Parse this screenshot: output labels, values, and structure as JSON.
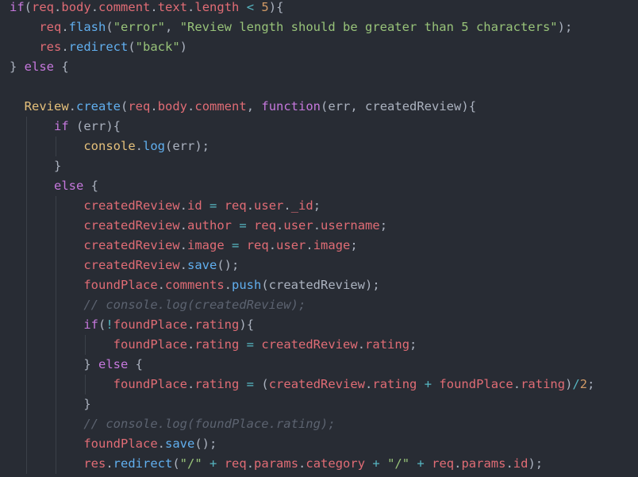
{
  "editor": {
    "colors": {
      "background": "#282c34",
      "keyword": "#c678dd",
      "variable": "#e06c75",
      "function": "#61afef",
      "string": "#98c379",
      "number": "#d19a66",
      "object": "#e5c07b",
      "operator": "#56b6c2",
      "punctuation": "#abb2bf",
      "comment": "#5c6370"
    },
    "lines": [
      {
        "indent": 0,
        "tokens": [
          {
            "t": "kw",
            "v": "if"
          },
          {
            "t": "punc",
            "v": "("
          },
          {
            "t": "var",
            "v": "req"
          },
          {
            "t": "punc",
            "v": "."
          },
          {
            "t": "var",
            "v": "body"
          },
          {
            "t": "punc",
            "v": "."
          },
          {
            "t": "var",
            "v": "comment"
          },
          {
            "t": "punc",
            "v": "."
          },
          {
            "t": "var",
            "v": "text"
          },
          {
            "t": "punc",
            "v": "."
          },
          {
            "t": "var",
            "v": "length"
          },
          {
            "t": "plain",
            "v": " "
          },
          {
            "t": "op",
            "v": "<"
          },
          {
            "t": "plain",
            "v": " "
          },
          {
            "t": "num",
            "v": "5"
          },
          {
            "t": "punc",
            "v": "){"
          }
        ]
      },
      {
        "indent": 4,
        "tokens": [
          {
            "t": "var",
            "v": "req"
          },
          {
            "t": "punc",
            "v": "."
          },
          {
            "t": "fn",
            "v": "flash"
          },
          {
            "t": "punc",
            "v": "("
          },
          {
            "t": "str",
            "v": "\"error\""
          },
          {
            "t": "punc",
            "v": ", "
          },
          {
            "t": "str",
            "v": "\"Review length should be greater than 5 characters\""
          },
          {
            "t": "punc",
            "v": ");"
          }
        ]
      },
      {
        "indent": 4,
        "tokens": [
          {
            "t": "var",
            "v": "res"
          },
          {
            "t": "punc",
            "v": "."
          },
          {
            "t": "fn",
            "v": "redirect"
          },
          {
            "t": "punc",
            "v": "("
          },
          {
            "t": "str",
            "v": "\"back\""
          },
          {
            "t": "punc",
            "v": ")"
          }
        ]
      },
      {
        "indent": 0,
        "tokens": [
          {
            "t": "punc",
            "v": "} "
          },
          {
            "t": "kw",
            "v": "else"
          },
          {
            "t": "punc",
            "v": " {"
          }
        ]
      },
      {
        "indent": 0,
        "tokens": []
      },
      {
        "indent": 2,
        "tokens": [
          {
            "t": "obj",
            "v": "Review"
          },
          {
            "t": "punc",
            "v": "."
          },
          {
            "t": "fn",
            "v": "create"
          },
          {
            "t": "punc",
            "v": "("
          },
          {
            "t": "var",
            "v": "req"
          },
          {
            "t": "punc",
            "v": "."
          },
          {
            "t": "var",
            "v": "body"
          },
          {
            "t": "punc",
            "v": "."
          },
          {
            "t": "var",
            "v": "comment"
          },
          {
            "t": "punc",
            "v": ", "
          },
          {
            "t": "kw",
            "v": "function"
          },
          {
            "t": "punc",
            "v": "("
          },
          {
            "t": "plain",
            "v": "err"
          },
          {
            "t": "punc",
            "v": ", "
          },
          {
            "t": "plain",
            "v": "createdReview"
          },
          {
            "t": "punc",
            "v": "){"
          }
        ]
      },
      {
        "indent": 6,
        "tokens": [
          {
            "t": "kw",
            "v": "if"
          },
          {
            "t": "punc",
            "v": " ("
          },
          {
            "t": "plain",
            "v": "err"
          },
          {
            "t": "punc",
            "v": "){"
          }
        ]
      },
      {
        "indent": 10,
        "tokens": [
          {
            "t": "obj",
            "v": "console"
          },
          {
            "t": "punc",
            "v": "."
          },
          {
            "t": "fn",
            "v": "log"
          },
          {
            "t": "punc",
            "v": "("
          },
          {
            "t": "plain",
            "v": "err"
          },
          {
            "t": "punc",
            "v": ");"
          }
        ]
      },
      {
        "indent": 6,
        "tokens": [
          {
            "t": "punc",
            "v": "}"
          }
        ]
      },
      {
        "indent": 6,
        "tokens": [
          {
            "t": "kw",
            "v": "else"
          },
          {
            "t": "punc",
            "v": " {"
          }
        ]
      },
      {
        "indent": 10,
        "tokens": [
          {
            "t": "var",
            "v": "createdReview"
          },
          {
            "t": "punc",
            "v": "."
          },
          {
            "t": "var",
            "v": "id"
          },
          {
            "t": "plain",
            "v": " "
          },
          {
            "t": "op",
            "v": "="
          },
          {
            "t": "plain",
            "v": " "
          },
          {
            "t": "var",
            "v": "req"
          },
          {
            "t": "punc",
            "v": "."
          },
          {
            "t": "var",
            "v": "user"
          },
          {
            "t": "punc",
            "v": "."
          },
          {
            "t": "var",
            "v": "_id"
          },
          {
            "t": "punc",
            "v": ";"
          }
        ]
      },
      {
        "indent": 10,
        "tokens": [
          {
            "t": "var",
            "v": "createdReview"
          },
          {
            "t": "punc",
            "v": "."
          },
          {
            "t": "var",
            "v": "author"
          },
          {
            "t": "plain",
            "v": " "
          },
          {
            "t": "op",
            "v": "="
          },
          {
            "t": "plain",
            "v": " "
          },
          {
            "t": "var",
            "v": "req"
          },
          {
            "t": "punc",
            "v": "."
          },
          {
            "t": "var",
            "v": "user"
          },
          {
            "t": "punc",
            "v": "."
          },
          {
            "t": "var",
            "v": "username"
          },
          {
            "t": "punc",
            "v": ";"
          }
        ]
      },
      {
        "indent": 10,
        "tokens": [
          {
            "t": "var",
            "v": "createdReview"
          },
          {
            "t": "punc",
            "v": "."
          },
          {
            "t": "var",
            "v": "image"
          },
          {
            "t": "plain",
            "v": " "
          },
          {
            "t": "op",
            "v": "="
          },
          {
            "t": "plain",
            "v": " "
          },
          {
            "t": "var",
            "v": "req"
          },
          {
            "t": "punc",
            "v": "."
          },
          {
            "t": "var",
            "v": "user"
          },
          {
            "t": "punc",
            "v": "."
          },
          {
            "t": "var",
            "v": "image"
          },
          {
            "t": "punc",
            "v": ";"
          }
        ]
      },
      {
        "indent": 10,
        "tokens": [
          {
            "t": "var",
            "v": "createdReview"
          },
          {
            "t": "punc",
            "v": "."
          },
          {
            "t": "fn",
            "v": "save"
          },
          {
            "t": "punc",
            "v": "();"
          }
        ]
      },
      {
        "indent": 10,
        "tokens": [
          {
            "t": "var",
            "v": "foundPlace"
          },
          {
            "t": "punc",
            "v": "."
          },
          {
            "t": "var",
            "v": "comments"
          },
          {
            "t": "punc",
            "v": "."
          },
          {
            "t": "fn",
            "v": "push"
          },
          {
            "t": "punc",
            "v": "("
          },
          {
            "t": "plain",
            "v": "createdReview"
          },
          {
            "t": "punc",
            "v": ");"
          }
        ]
      },
      {
        "indent": 10,
        "tokens": [
          {
            "t": "com",
            "v": "// console.log(createdReview);"
          }
        ]
      },
      {
        "indent": 10,
        "tokens": [
          {
            "t": "kw",
            "v": "if"
          },
          {
            "t": "punc",
            "v": "("
          },
          {
            "t": "op",
            "v": "!"
          },
          {
            "t": "var",
            "v": "foundPlace"
          },
          {
            "t": "punc",
            "v": "."
          },
          {
            "t": "var",
            "v": "rating"
          },
          {
            "t": "punc",
            "v": "){"
          }
        ]
      },
      {
        "indent": 14,
        "tokens": [
          {
            "t": "var",
            "v": "foundPlace"
          },
          {
            "t": "punc",
            "v": "."
          },
          {
            "t": "var",
            "v": "rating"
          },
          {
            "t": "plain",
            "v": " "
          },
          {
            "t": "op",
            "v": "="
          },
          {
            "t": "plain",
            "v": " "
          },
          {
            "t": "var",
            "v": "createdReview"
          },
          {
            "t": "punc",
            "v": "."
          },
          {
            "t": "var",
            "v": "rating"
          },
          {
            "t": "punc",
            "v": ";"
          }
        ]
      },
      {
        "indent": 10,
        "tokens": [
          {
            "t": "punc",
            "v": "} "
          },
          {
            "t": "kw",
            "v": "else"
          },
          {
            "t": "punc",
            "v": " {"
          }
        ]
      },
      {
        "indent": 14,
        "tokens": [
          {
            "t": "var",
            "v": "foundPlace"
          },
          {
            "t": "punc",
            "v": "."
          },
          {
            "t": "var",
            "v": "rating"
          },
          {
            "t": "plain",
            "v": " "
          },
          {
            "t": "op",
            "v": "="
          },
          {
            "t": "plain",
            "v": " "
          },
          {
            "t": "punc",
            "v": "("
          },
          {
            "t": "var",
            "v": "createdReview"
          },
          {
            "t": "punc",
            "v": "."
          },
          {
            "t": "var",
            "v": "rating"
          },
          {
            "t": "plain",
            "v": " "
          },
          {
            "t": "op",
            "v": "+"
          },
          {
            "t": "plain",
            "v": " "
          },
          {
            "t": "var",
            "v": "foundPlace"
          },
          {
            "t": "punc",
            "v": "."
          },
          {
            "t": "var",
            "v": "rating"
          },
          {
            "t": "punc",
            "v": ")"
          },
          {
            "t": "op",
            "v": "/"
          },
          {
            "t": "num",
            "v": "2"
          },
          {
            "t": "punc",
            "v": ";"
          }
        ]
      },
      {
        "indent": 10,
        "tokens": [
          {
            "t": "punc",
            "v": "}"
          }
        ]
      },
      {
        "indent": 10,
        "tokens": [
          {
            "t": "com",
            "v": "// console.log(foundPlace.rating);"
          }
        ]
      },
      {
        "indent": 10,
        "tokens": [
          {
            "t": "var",
            "v": "foundPlace"
          },
          {
            "t": "punc",
            "v": "."
          },
          {
            "t": "fn",
            "v": "save"
          },
          {
            "t": "punc",
            "v": "();"
          }
        ]
      },
      {
        "indent": 10,
        "tokens": [
          {
            "t": "var",
            "v": "res"
          },
          {
            "t": "punc",
            "v": "."
          },
          {
            "t": "fn",
            "v": "redirect"
          },
          {
            "t": "punc",
            "v": "("
          },
          {
            "t": "str",
            "v": "\"/\""
          },
          {
            "t": "plain",
            "v": " "
          },
          {
            "t": "op",
            "v": "+"
          },
          {
            "t": "plain",
            "v": " "
          },
          {
            "t": "var",
            "v": "req"
          },
          {
            "t": "punc",
            "v": "."
          },
          {
            "t": "var",
            "v": "params"
          },
          {
            "t": "punc",
            "v": "."
          },
          {
            "t": "var",
            "v": "category"
          },
          {
            "t": "plain",
            "v": " "
          },
          {
            "t": "op",
            "v": "+"
          },
          {
            "t": "plain",
            "v": " "
          },
          {
            "t": "str",
            "v": "\"/\""
          },
          {
            "t": "plain",
            "v": " "
          },
          {
            "t": "op",
            "v": "+"
          },
          {
            "t": "plain",
            "v": " "
          },
          {
            "t": "var",
            "v": "req"
          },
          {
            "t": "punc",
            "v": "."
          },
          {
            "t": "var",
            "v": "params"
          },
          {
            "t": "punc",
            "v": "."
          },
          {
            "t": "var",
            "v": "id"
          },
          {
            "t": "punc",
            "v": ");"
          }
        ]
      }
    ]
  }
}
